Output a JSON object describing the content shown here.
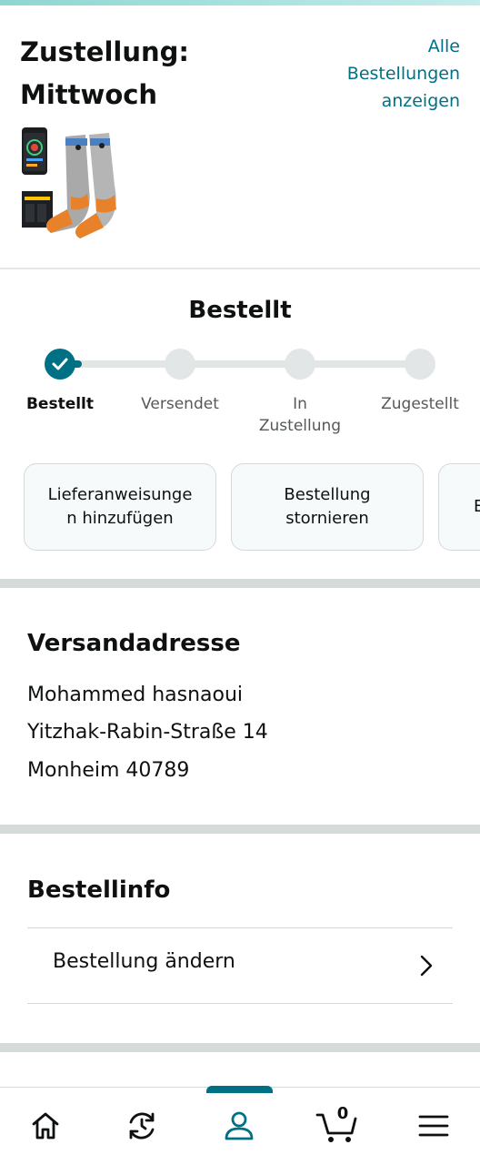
{
  "delivery": {
    "title_line1": "Zustellung:",
    "title_line2": "Mittwoch",
    "all_orders_line1": "Alle",
    "all_orders_line2": "Bestellungen",
    "all_orders_line3": "anzeigen"
  },
  "status": {
    "title": "Bestellt",
    "steps": [
      {
        "label": "Bestellt",
        "done": true
      },
      {
        "label": "Versendet",
        "done": false
      },
      {
        "label_line1": "In",
        "label_line2": "Zustellung",
        "done": false
      },
      {
        "label": "Zugestellt",
        "done": false
      }
    ],
    "progress": 0.0
  },
  "actions": [
    {
      "label_line1": "Lieferanweisunge",
      "label_line2": "n hinzufügen"
    },
    {
      "label_line1": "Bestellung",
      "label_line2": "stornieren"
    },
    {
      "label_line1": "E",
      "label_line2": ""
    }
  ],
  "shipping": {
    "title": "Versandadresse",
    "name": "Mohammed hasnaoui",
    "street": "Yitzhak-Rabin-Straße 14",
    "city": "Monheim 40789"
  },
  "order_info": {
    "title": "Bestellinfo",
    "change_order_label": "Bestellung ändern"
  },
  "bottom_nav": {
    "active": "account",
    "cart_count": "0",
    "items": [
      "home-icon",
      "history-icon",
      "account-icon",
      "cart-icon",
      "menu-icon"
    ]
  },
  "colors": {
    "accent": "#007185",
    "inactive": "#e3e6e6",
    "divider": "#d5dbdb"
  }
}
